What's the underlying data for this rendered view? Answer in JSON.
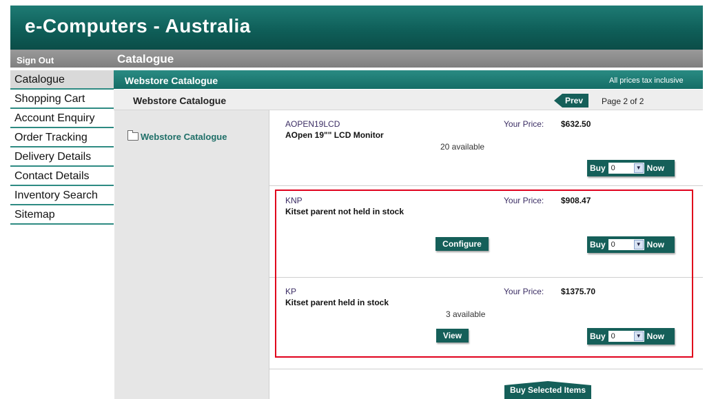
{
  "header": {
    "title": "e-Computers - Australia"
  },
  "navbar": {
    "signout": "Sign Out",
    "breadcrumb": "Catalogue"
  },
  "sidebar": {
    "items": [
      {
        "label": "Catalogue"
      },
      {
        "label": "Shopping Cart"
      },
      {
        "label": "Account Enquiry"
      },
      {
        "label": "Order Tracking"
      },
      {
        "label": "Delivery Details"
      },
      {
        "label": "Contact Details"
      },
      {
        "label": "Inventory Search"
      },
      {
        "label": "Sitemap"
      }
    ]
  },
  "content": {
    "title": "Webstore Catalogue",
    "tax_note": "All prices tax inclusive",
    "subtitle": "Webstore Catalogue",
    "prev_label": "Prev",
    "page_info": "Page 2 of 2",
    "tree_root": "Webstore Catalogue"
  },
  "products": [
    {
      "code": "AOPEN19LCD",
      "name": "AOpen 19\"\" LCD Monitor",
      "available": "20 available",
      "price_label": "Your Price:",
      "price": "$632.50",
      "qty": "0",
      "action": ""
    },
    {
      "code": "KNP",
      "name": "Kitset parent not held in stock",
      "available": "",
      "price_label": "Your Price:",
      "price": "$908.47",
      "qty": "0",
      "action": "Configure"
    },
    {
      "code": "KP",
      "name": "Kitset parent held in stock",
      "available": "3 available",
      "price_label": "Your Price:",
      "price": "$1375.70",
      "qty": "0",
      "action": "View"
    }
  ],
  "buy": {
    "buy_label": "Buy",
    "now_label": "Now",
    "dropdown_icon": "chevron-down-icon"
  },
  "footer": {
    "buy_selected": "Buy Selected Items"
  },
  "colors": {
    "teal": "#155f59",
    "highlight": "#e0001b"
  }
}
